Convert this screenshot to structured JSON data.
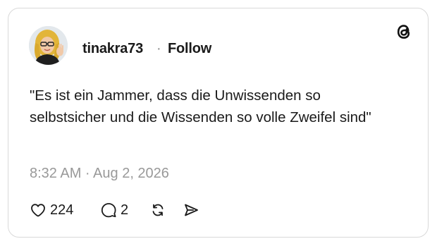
{
  "post": {
    "username": "tinakra73",
    "separator": "·",
    "follow_label": "Follow",
    "text": "\"Es ist ein Jammer, dass die Unwissenden so selbstsicher und die Wissenden so volle Zweifel sind\"",
    "timestamp": "8:32 AM · Aug 2, 2026"
  },
  "actions": {
    "likes": "224",
    "replies": "2"
  },
  "icons": {
    "brand": "threads-logo-icon",
    "like": "heart-icon",
    "reply": "speech-bubble-icon",
    "repost": "repost-icon",
    "share": "send-icon"
  },
  "colors": {
    "text": "#1a1a1a",
    "muted": "#999999",
    "border": "#d9d9d9"
  }
}
